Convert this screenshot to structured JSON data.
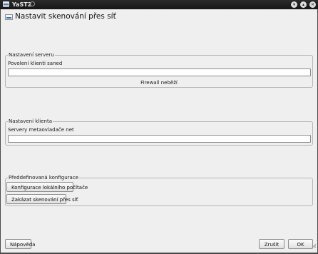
{
  "window": {
    "title": "YaST2",
    "titlebar_buttons": [
      "minimize-icon",
      "maximize-icon",
      "close-icon"
    ]
  },
  "heading": "Nastavit skenování přes síť",
  "server_group": {
    "legend": "Nastavení serveru",
    "field_label": "Povolení klienti saned",
    "field_value": "",
    "status": "Firewall neběží"
  },
  "client_group": {
    "legend": "Nastavení klienta",
    "field_label": "Servery metaovladače net",
    "field_value": ""
  },
  "preset_group": {
    "legend": "Předdefinovaná konfigurace",
    "local_config_button": "Konfigurace lokálního počítače",
    "disable_button": "Zakázat skenování přes síť"
  },
  "footer": {
    "help_button": "Nápověda",
    "cancel_button": "Zrušit",
    "ok_button": "OK"
  }
}
